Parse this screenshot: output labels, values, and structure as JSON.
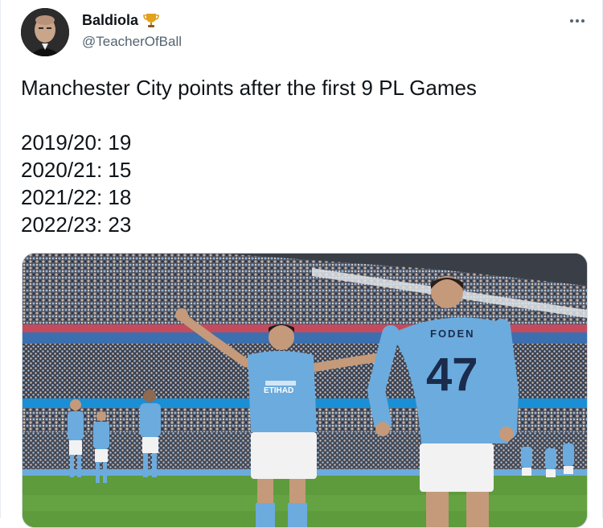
{
  "author": {
    "display_name": "Baldiola",
    "handle": "@TeacherOfBall",
    "badge_icon": "trophy-icon"
  },
  "tweet": {
    "headline": "Manchester City points after the first 9 PL Games",
    "stats": [
      "2019/20: 19",
      "2020/21: 15",
      "2021/22: 18",
      "2022/23: 23"
    ]
  },
  "media": {
    "shirt_sponsor": "ETIHAD",
    "player_name": "FODEN",
    "player_number": "47"
  },
  "colors": {
    "text_primary": "#0f1419",
    "text_secondary": "#536471",
    "city_blue": "#6cabdd",
    "pitch_green": "#5e9b3c"
  }
}
